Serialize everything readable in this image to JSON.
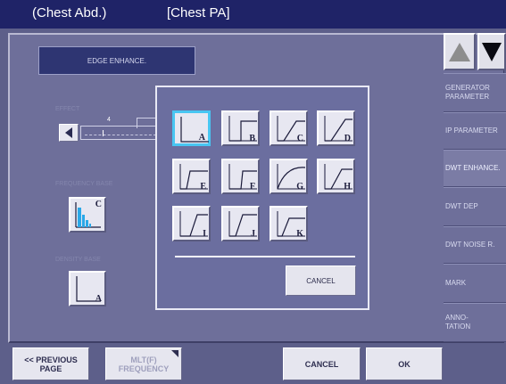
{
  "titlebar": {
    "left": "(Chest Abd.)",
    "right": "[Chest PA]"
  },
  "edge": {
    "label": "EDGE ENHANCE."
  },
  "effect": {
    "label": "EFFECT",
    "value": "4"
  },
  "frequency_base": {
    "label": "FREQUENCY BASE",
    "letter": "C"
  },
  "density_base": {
    "label": "DENSITY BASE",
    "letter": "A"
  },
  "dialog": {
    "options": [
      {
        "letter": "A",
        "selected": true
      },
      {
        "letter": "B",
        "selected": false
      },
      {
        "letter": "C",
        "selected": false
      },
      {
        "letter": "D",
        "selected": false
      },
      {
        "letter": "E",
        "selected": false
      },
      {
        "letter": "F",
        "selected": false
      },
      {
        "letter": "G",
        "selected": false
      },
      {
        "letter": "H",
        "selected": false
      },
      {
        "letter": "I",
        "selected": false
      },
      {
        "letter": "J",
        "selected": false
      },
      {
        "letter": "K",
        "selected": false
      }
    ],
    "cancel_label": "CANCEL"
  },
  "sidebar": {
    "items": [
      {
        "label1": "GENERATOR",
        "label2": "PARAMETER",
        "active": false
      },
      {
        "label1": "IP PARAMETER",
        "label2": "",
        "active": false
      },
      {
        "label1": "DWT ENHANCE.",
        "label2": "",
        "active": true
      },
      {
        "label1": "DWT DEP",
        "label2": "",
        "active": false
      },
      {
        "label1": "DWT NOISE R.",
        "label2": "",
        "active": false
      },
      {
        "label1": "MARK",
        "label2": "",
        "active": false
      },
      {
        "label1": "ANNO-",
        "label2": "TATION",
        "active": false
      }
    ]
  },
  "bottom": {
    "prev_line1": "<< PREVIOUS",
    "prev_line2": "PAGE",
    "mlt_line1": "MLT(F)",
    "mlt_line2": "FREQUENCY",
    "cancel": "CANCEL",
    "ok": "OK"
  },
  "colors": {
    "title_bar": "#1f2367",
    "background": "#5d5f8a",
    "selection": "#48c6f2"
  }
}
